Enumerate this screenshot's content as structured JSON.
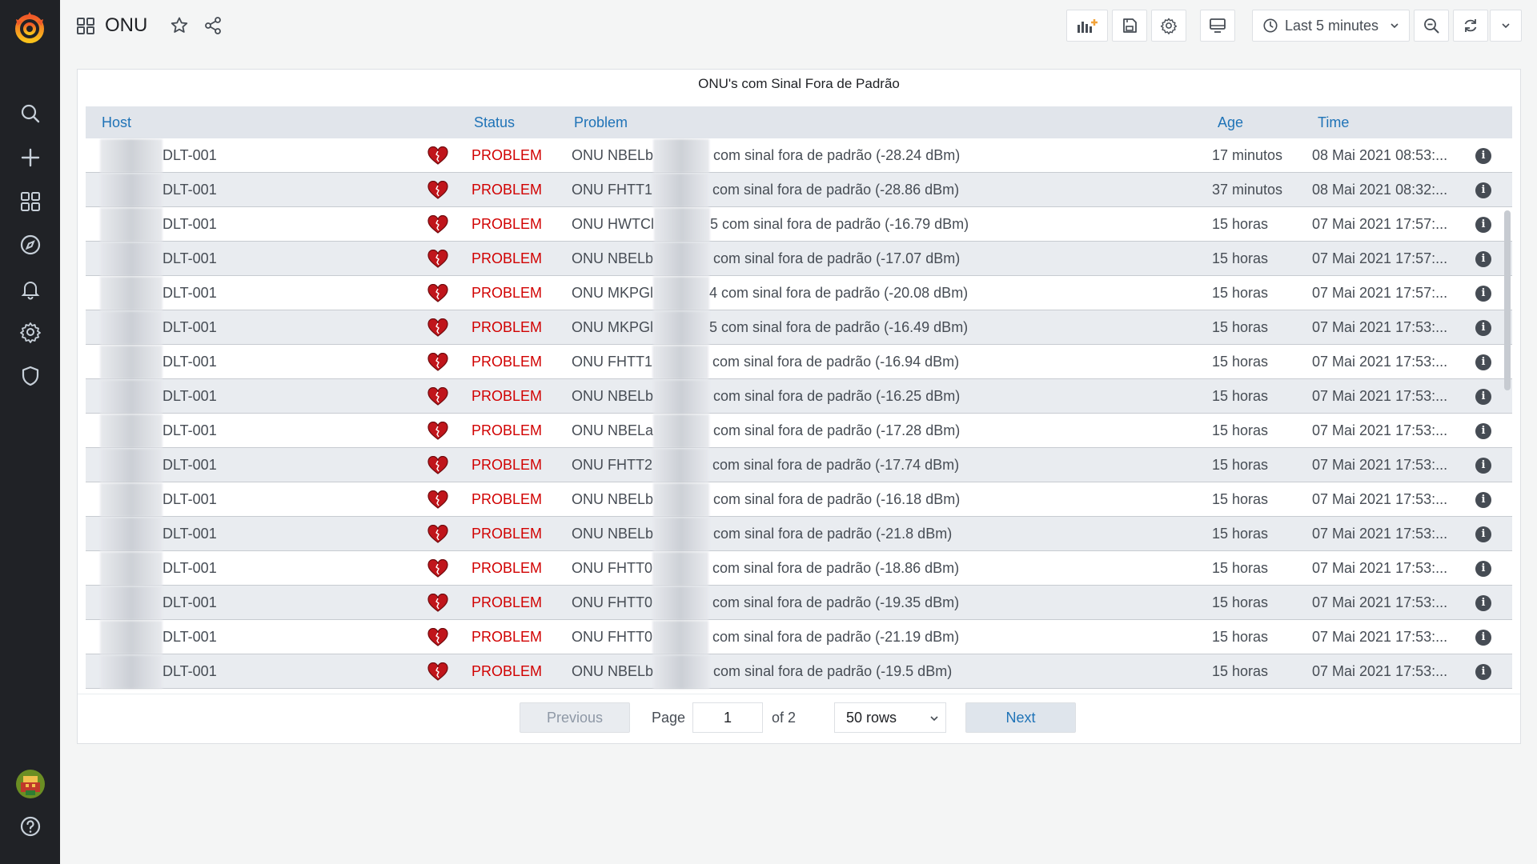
{
  "dashboard": {
    "title": "ONU"
  },
  "toolbar": {
    "time_range": "Last 5 minutes"
  },
  "sidebar": {
    "items": [
      "search",
      "create",
      "dashboards",
      "explore",
      "alerting",
      "configuration",
      "server-admin"
    ]
  },
  "panel": {
    "title": "ONU's com Sinal Fora de Padrão",
    "columns": {
      "host": "Host",
      "status": "Status",
      "problem": "Problem",
      "age": "Age",
      "time": "Time"
    },
    "rows": [
      {
        "host_suffix": "DLT-001",
        "status": "PROBLEM",
        "problem_prefix": "ONU NBELb",
        "problem_suffix": " com sinal fora de padrão (-28.24 dBm)",
        "age": "17 minutos",
        "time": "08 Mai 2021 08:53:..."
      },
      {
        "host_suffix": "DLT-001",
        "status": "PROBLEM",
        "problem_prefix": "ONU FHTT1",
        "problem_suffix": " com sinal fora de padrão (-28.86 dBm)",
        "age": "37 minutos",
        "time": "08 Mai 2021 08:32:..."
      },
      {
        "host_suffix": "DLT-001",
        "status": "PROBLEM",
        "problem_prefix": "ONU HWTCl",
        "problem_suffix": "5 com sinal fora de padrão (-16.79 dBm)",
        "age": "15 horas",
        "time": "07 Mai 2021 17:57:..."
      },
      {
        "host_suffix": "DLT-001",
        "status": "PROBLEM",
        "problem_prefix": "ONU NBELb",
        "problem_suffix": " com sinal fora de padrão (-17.07 dBm)",
        "age": "15 horas",
        "time": "07 Mai 2021 17:57:..."
      },
      {
        "host_suffix": "DLT-001",
        "status": "PROBLEM",
        "problem_prefix": "ONU MKPGl",
        "problem_suffix": "4 com sinal fora de padrão (-20.08 dBm)",
        "age": "15 horas",
        "time": "07 Mai 2021 17:57:..."
      },
      {
        "host_suffix": "DLT-001",
        "status": "PROBLEM",
        "problem_prefix": "ONU MKPGl",
        "problem_suffix": "5 com sinal fora de padrão (-16.49 dBm)",
        "age": "15 horas",
        "time": "07 Mai 2021 17:53:..."
      },
      {
        "host_suffix": "DLT-001",
        "status": "PROBLEM",
        "problem_prefix": "ONU FHTT1",
        "problem_suffix": " com sinal fora de padrão (-16.94 dBm)",
        "age": "15 horas",
        "time": "07 Mai 2021 17:53:..."
      },
      {
        "host_suffix": "DLT-001",
        "status": "PROBLEM",
        "problem_prefix": "ONU NBELb",
        "problem_suffix": " com sinal fora de padrão (-16.25 dBm)",
        "age": "15 horas",
        "time": "07 Mai 2021 17:53:..."
      },
      {
        "host_suffix": "DLT-001",
        "status": "PROBLEM",
        "problem_prefix": "ONU NBELa",
        "problem_suffix": " com sinal fora de padrão (-17.28 dBm)",
        "age": "15 horas",
        "time": "07 Mai 2021 17:53:..."
      },
      {
        "host_suffix": "DLT-001",
        "status": "PROBLEM",
        "problem_prefix": "ONU FHTT2",
        "problem_suffix": " com sinal fora de padrão (-17.74 dBm)",
        "age": "15 horas",
        "time": "07 Mai 2021 17:53:..."
      },
      {
        "host_suffix": "DLT-001",
        "status": "PROBLEM",
        "problem_prefix": "ONU NBELb",
        "problem_suffix": " com sinal fora de padrão (-16.18 dBm)",
        "age": "15 horas",
        "time": "07 Mai 2021 17:53:..."
      },
      {
        "host_suffix": "DLT-001",
        "status": "PROBLEM",
        "problem_prefix": "ONU NBELb",
        "problem_suffix": " com sinal fora de padrão (-21.8 dBm)",
        "age": "15 horas",
        "time": "07 Mai 2021 17:53:..."
      },
      {
        "host_suffix": "DLT-001",
        "status": "PROBLEM",
        "problem_prefix": "ONU FHTT0",
        "problem_suffix": " com sinal fora de padrão (-18.86 dBm)",
        "age": "15 horas",
        "time": "07 Mai 2021 17:53:..."
      },
      {
        "host_suffix": "DLT-001",
        "status": "PROBLEM",
        "problem_prefix": "ONU FHTT0",
        "problem_suffix": " com sinal fora de padrão (-19.35 dBm)",
        "age": "15 horas",
        "time": "07 Mai 2021 17:53:..."
      },
      {
        "host_suffix": "DLT-001",
        "status": "PROBLEM",
        "problem_prefix": "ONU FHTT0",
        "problem_suffix": " com sinal fora de padrão (-21.19 dBm)",
        "age": "15 horas",
        "time": "07 Mai 2021 17:53:..."
      },
      {
        "host_suffix": "DLT-001",
        "status": "PROBLEM",
        "problem_prefix": "ONU NBELb",
        "problem_suffix": " com sinal fora de padrão (-19.5 dBm)",
        "age": "15 horas",
        "time": "07 Mai 2021 17:53:..."
      }
    ]
  },
  "pagination": {
    "previous": "Previous",
    "page_label": "Page",
    "page_value": "1",
    "of_label": "of 2",
    "rows_option": "50 rows",
    "next": "Next"
  },
  "colors": {
    "problem": "#d10000",
    "link": "#1f73b7",
    "sidebar": "#202226"
  }
}
